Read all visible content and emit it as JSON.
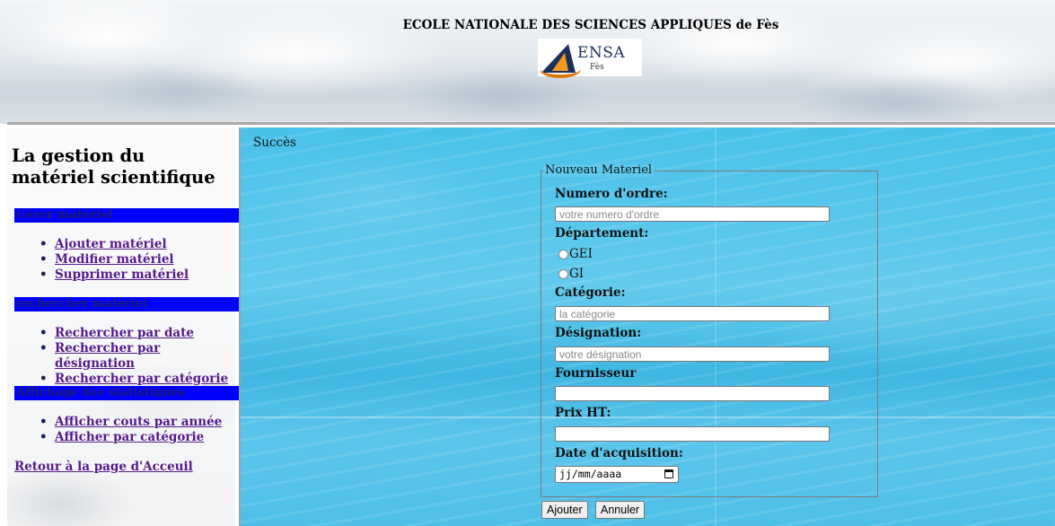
{
  "header": {
    "school_name": "ECOLE NATIONALE DES SCIENCES APPLIQUES de Fès",
    "logo_text": "ENSA",
    "logo_sub": "Fès"
  },
  "sidebar": {
    "title": "La gestion du matériel scientifique",
    "sections": [
      {
        "label": "Gérer matériel",
        "items": [
          "Ajouter matériel",
          "Modifier matériel",
          "Supprimer matériel"
        ]
      },
      {
        "label": "rechercher matériel",
        "items": [
          "Rechercher par date",
          "Rechercher par désignation",
          "Rechercher par catégorie"
        ]
      },
      {
        "label": "Affichage des statistiques",
        "items": [
          "Afficher couts par année",
          "Afficher par catégorie"
        ]
      }
    ],
    "home_link": "Retour à la page d'Acceuil"
  },
  "main": {
    "status": "Succès",
    "form": {
      "legend": "Nouveau Materiel",
      "numero": {
        "label": "Numero d'ordre:",
        "placeholder": "votre numero d'ordre",
        "value": ""
      },
      "departement": {
        "label": "Département:",
        "options": [
          "GEI",
          "GI"
        ]
      },
      "categorie": {
        "label": "Catégorie:",
        "placeholder": "la catégorie",
        "value": ""
      },
      "designation": {
        "label": "Désignation:",
        "placeholder": "votre désignation",
        "value": ""
      },
      "fournisseur": {
        "label": "Fournisseur",
        "value": ""
      },
      "prix": {
        "label": "Prix HT:",
        "value": ""
      },
      "date": {
        "label": "Date d'acquisition:",
        "placeholder": "jj/mm/aaaa"
      },
      "submit_label": "Ajouter",
      "cancel_label": "Annuler"
    }
  },
  "colors": {
    "section_bar": "#0000ff",
    "link": "#551a8b",
    "main_bg": "#49c1ea"
  }
}
